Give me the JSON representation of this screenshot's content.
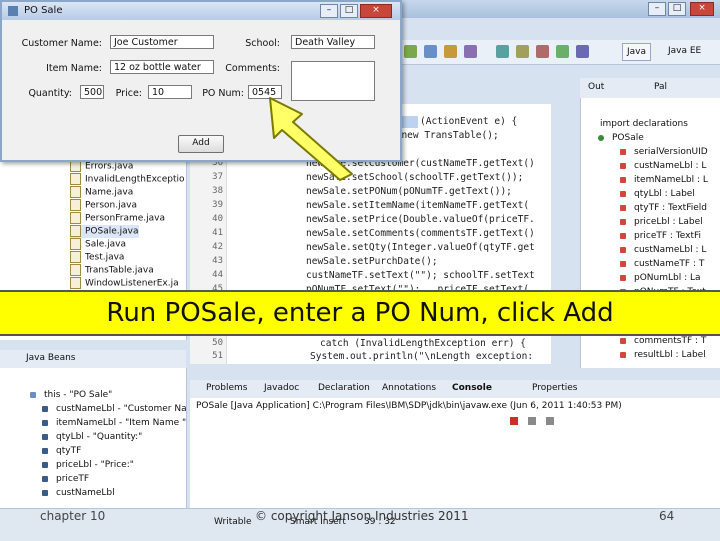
{
  "po_dialog": {
    "title": "PO Sale",
    "customer_name_label": "Customer Name:",
    "customer_name_value": "Joe Customer",
    "school_label": "School:",
    "school_value": "Death Valley",
    "item_name_label": "Item Name:",
    "item_name_value": "12 oz bottle water",
    "comments_label": "Comments:",
    "quantity_label": "Quantity:",
    "quantity_value": "500",
    "price_label": "Price:",
    "price_value": "10",
    "po_num_label": "PO Num:",
    "po_num_value": "0545",
    "add_label": "Add",
    "minimize": "–",
    "maximize": "□",
    "close": "×"
  },
  "ide_window": {
    "minimize": "–",
    "maximize": "□",
    "close": "×"
  },
  "toolbar": {
    "java_perspective": "Java",
    "javaee_perspective": "Java EE"
  },
  "package_explorer": {
    "items": [
      "Errors.java",
      "InvalidLengthExceptio",
      "Name.java",
      "Person.java",
      "PersonFrame.java",
      "POSale.java",
      "Sale.java",
      "Test.java",
      "TransTable.java",
      "WindowListenerEx.ja"
    ]
  },
  "editor": {
    "line_numbers": [
      "36",
      "37",
      "38",
      "39",
      "40",
      "41",
      "42",
      "43",
      "44",
      "45",
      "50",
      "51"
    ],
    "lines": [
      "(ActionEvent e) {",
      "= new TransTable();",
      "newSale.setCustomer(custNameTF.getText()",
      "newSale.setSchool(schoolTF.getText());",
      "newSale.setPONum(pONumTF.getText());",
      "newSale.setItemName(itemNameTF.getText(",
      "newSale.setPrice(Double.valueOf(priceTF.",
      "newSale.setComments(commentsTF.getText()",
      "newSale.setQty(Integer.valueOf(qtyTF.get",
      "newSale.setPurchDate();",
      "custNameTF.setText(\"\"); schoolTF.setText",
      "pONumTF.setText(\"\");   priceTF.setText(",
      "catch (InvalidLengthException err) {",
      "System.out.println(\"\\nLength exception:"
    ]
  },
  "outline": {
    "tab_outline": "Out",
    "tab_palette": "Pal",
    "items": [
      "import declarations",
      "POSale",
      "serialVersionUID",
      "custNameLbl : L",
      "itemNameLbl : L",
      "qtyLbl : Label",
      "qtyTF : TextField",
      "priceLbl : Label",
      "priceTF : TextFi",
      "custNameLbl : L",
      "custNameTF : T",
      "pONumLbl : La",
      "pONumTF : Text",
      "commentsTF : T",
      "resultLbl : Label"
    ]
  },
  "java_beans": {
    "title": "Java Beans",
    "items": [
      "this - \"PO Sale\"",
      "custNameLbl - \"Customer Na",
      "itemNameLbl - \"Item Name \"",
      "qtyLbl - \"Quantity:\"",
      "qtyTF",
      "priceLbl - \"Price:\"",
      "priceTF",
      "custNameLbl"
    ]
  },
  "console": {
    "tabs": [
      "Problems",
      "Javadoc",
      "Declaration",
      "Annotations",
      "Console",
      "Properties"
    ],
    "status_line": "POSale [Java Application] C:\\Program Files\\IBM\\SDP\\jdk\\bin\\javaw.exe (Jun 6, 2011 1:40:53 PM)"
  },
  "status_bar": {
    "writable": "Writable",
    "smart_insert": "Smart Insert",
    "position": "39 : 32"
  },
  "caption": "Run POSale, enter a PO Num, click Add",
  "footer": {
    "chapter": "chapter 10",
    "copyright": "© copyright Janson Industries 2011",
    "page": "64"
  },
  "colors": {
    "caption_band": "#ffff00",
    "arrow_fill": "#ffff66",
    "arrow_stroke": "#7a7a00"
  },
  "icons": [
    "package-icon",
    "java-file-icon",
    "field-icon",
    "minimize-icon",
    "maximize-icon",
    "close-icon",
    "arrow-pointer-icon"
  ]
}
